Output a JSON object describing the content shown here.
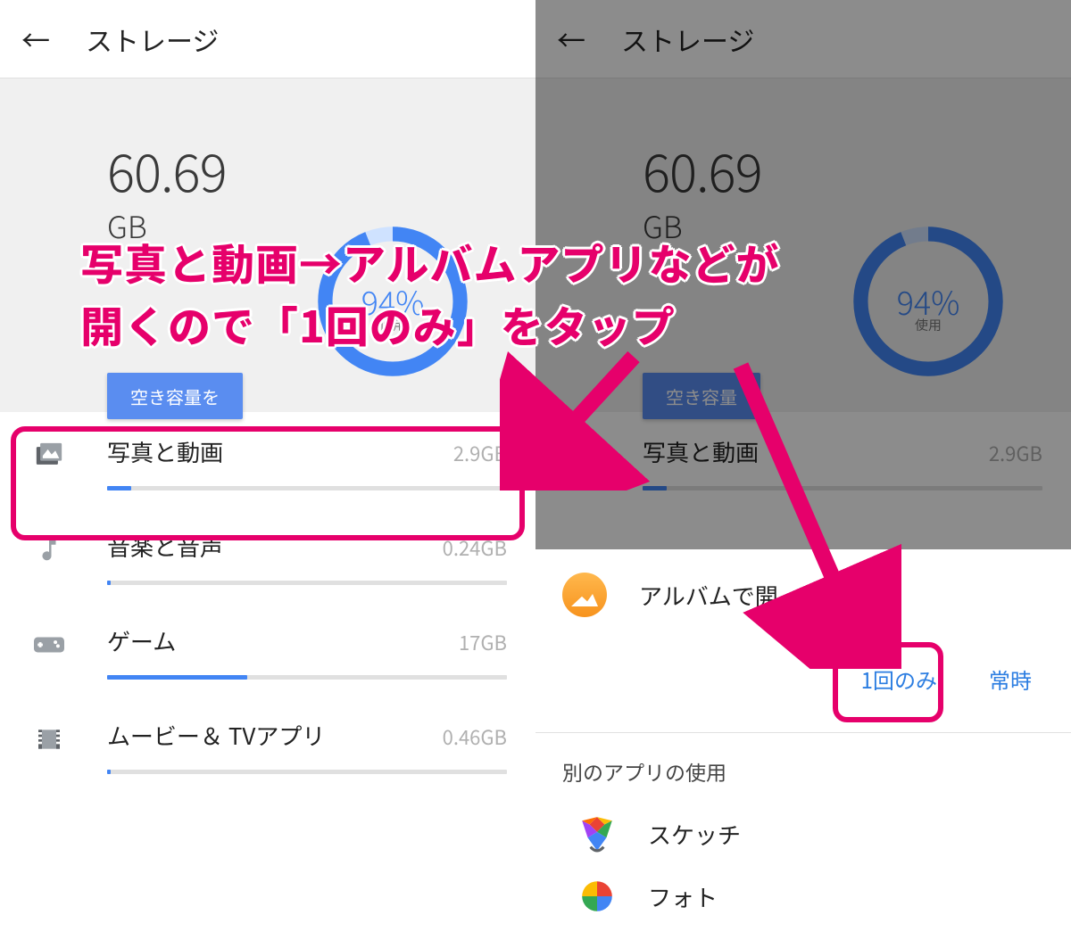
{
  "annotation": {
    "line1": "写真と動画→アルバムアプリなどが",
    "line2": "開くので「1回のみ」をタップ"
  },
  "left": {
    "title": "ストレージ",
    "used_value": "60.69",
    "used_unit": "GB",
    "percent": "94%",
    "percent_sub": "使用",
    "free_button": "空き容量を",
    "categories": [
      {
        "name": "写真と動画",
        "size": "2.9GB",
        "fill": 6
      },
      {
        "name": "音楽と音声",
        "size": "0.24GB",
        "fill": 1
      },
      {
        "name": "ゲーム",
        "size": "17GB",
        "fill": 35
      },
      {
        "name": "ムービー＆ TVアプリ",
        "size": "0.46GB",
        "fill": 1
      }
    ]
  },
  "right": {
    "title": "ストレージ",
    "used_value": "60.69",
    "used_unit": "GB",
    "percent": "94%",
    "percent_sub": "使用",
    "free_button": "空き容量",
    "category": {
      "name": "写真と動画",
      "size": "2.9GB",
      "fill": 6
    },
    "chooser": {
      "title": "アルバムで開",
      "once": "1回のみ",
      "always": "常時",
      "other_apps_title": "別のアプリの使用",
      "apps": [
        {
          "name": "スケッチ"
        },
        {
          "name": "フォト"
        }
      ]
    }
  }
}
